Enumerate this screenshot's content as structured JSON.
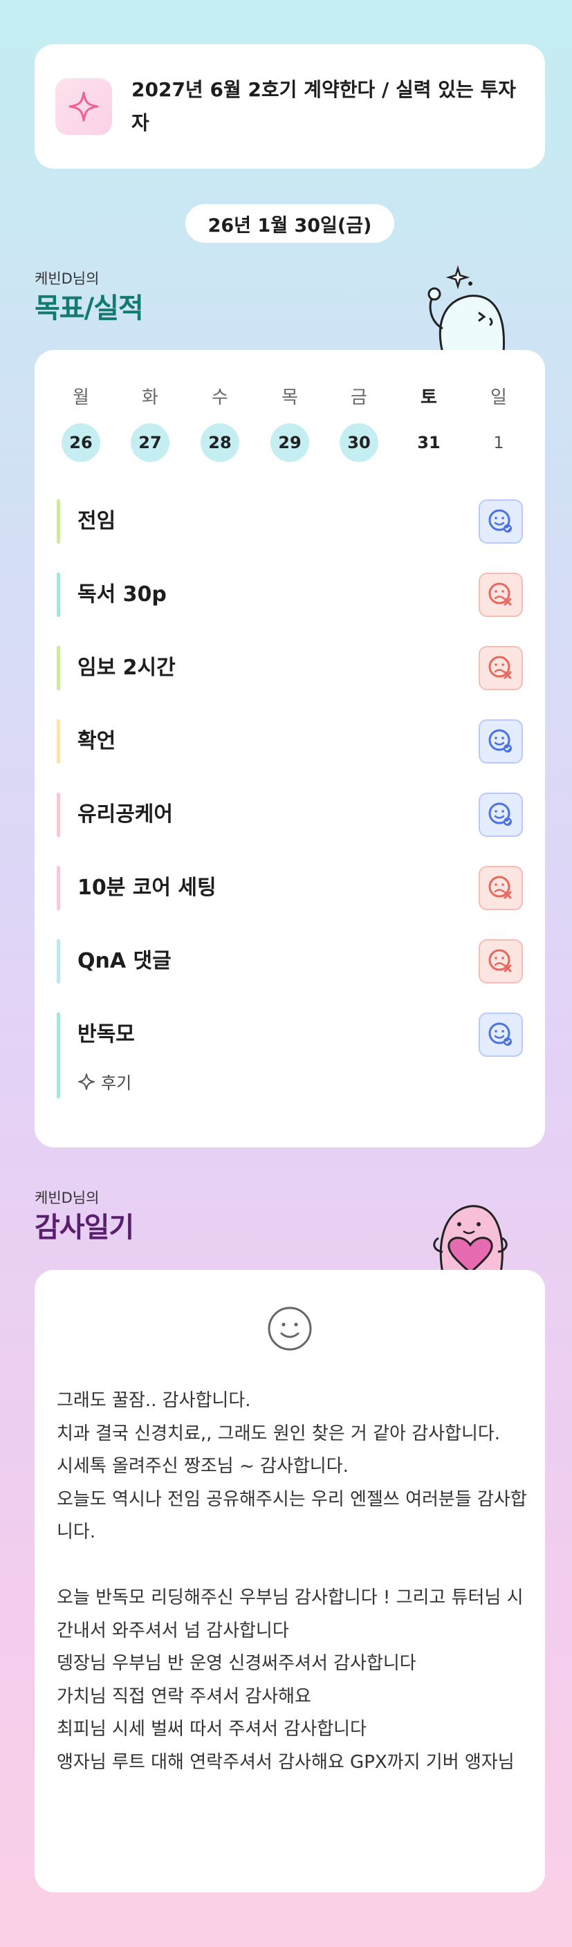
{
  "goal_banner": {
    "text": "2027년 6월 2호기 계약한다 / 실력 있는 투자자",
    "icon": "sparkle-icon"
  },
  "date": "26년 1월 30일(금)",
  "goals_section": {
    "subtitle": "케빈D님의",
    "title": "목표/실적"
  },
  "week": {
    "days": [
      "월",
      "화",
      "수",
      "목",
      "금",
      "토",
      "일"
    ],
    "dates": [
      "26",
      "27",
      "28",
      "29",
      "30",
      "31",
      "1"
    ]
  },
  "goals": [
    {
      "label": "전임",
      "status": "done",
      "bar_color": "#cfe8a2"
    },
    {
      "label": "독서 30p",
      "status": "missed",
      "bar_color": "#a7e6d9"
    },
    {
      "label": "임보 2시간",
      "status": "missed",
      "bar_color": "#cfe8a2"
    },
    {
      "label": "확언",
      "status": "done",
      "bar_color": "#fde2b0"
    },
    {
      "label": "유리공케어",
      "status": "done",
      "bar_color": "#f9c7cd"
    },
    {
      "label": "10분 코어 세팅",
      "status": "missed",
      "bar_color": "#f8c8dd"
    },
    {
      "label": "QnA 댓글",
      "status": "missed",
      "bar_color": "#bfe6f2"
    },
    {
      "label": "반독모",
      "status": "done",
      "bar_color": "#a7e6d9"
    }
  ],
  "review_label": "후기",
  "diary_section": {
    "subtitle": "케빈D님의",
    "title": "감사일기"
  },
  "diary_text": "그래도 꿀잠.. 감사합니다.\n치과 결국 신경치료,, 그래도 원인 찾은 거 같아 감사합니다.\n시세톡 올려주신 짱조님 ~ 감사합니다.\n오늘도 역시나 전임 공유해주시는 우리 엔젤쓰 여러분들 감사합니다.\n\n오늘 반독모 리딩해주신 우부님 감사합니다 ! 그리고 튜터님 시간내서 와주셔서 넘 감사합니다\n뎅장님 우부님 반 운영 신경써주셔서 감사합니다\n가치님 직접 연락 주셔서 감사해요\n최피님 시세 벌써 따서 주셔서 감사합니다\n앵자님 루트 대해 연락주셔서 감사해요 GPX까지 기버 앵자님",
  "colors": {
    "title_green": "#127a72",
    "title_purple": "#5a1e6f",
    "status_ok": "#4a72e6",
    "status_no": "#e8665b"
  }
}
